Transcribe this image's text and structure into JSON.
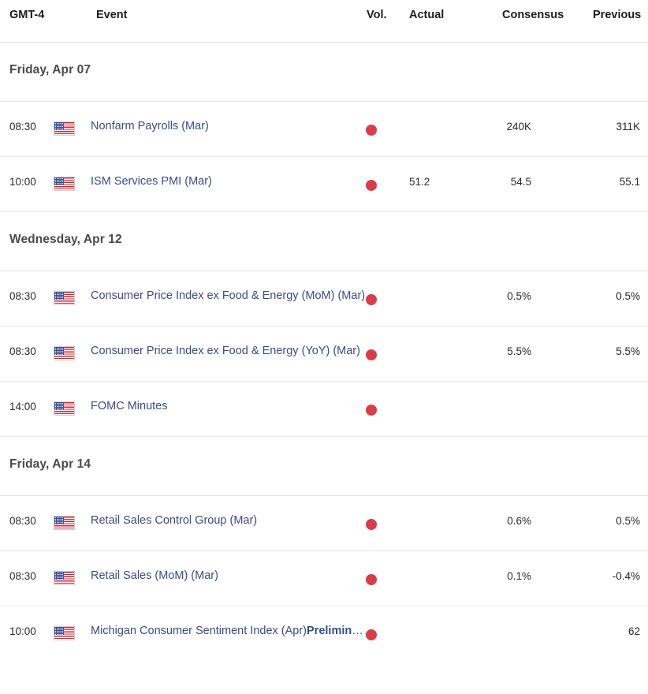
{
  "columns": {
    "timezone": "GMT-4",
    "event": "Event",
    "vol": "Vol.",
    "actual": "Actual",
    "consensus": "Consensus",
    "previous": "Previous"
  },
  "colors": {
    "link": "#3b4a8c",
    "volatility_high": "#d93d4a",
    "divider": "#e2e2e2",
    "date_header_text": "#4a4a4a"
  },
  "icons": {
    "flag": "us-flag-icon",
    "volatility": "volatility-dot-icon"
  },
  "groups": [
    {
      "date": "Friday, Apr 07",
      "rows": [
        {
          "time": "08:30",
          "country": "United States",
          "event": "Nonfarm Payrolls (Mar)",
          "event_prelim": "",
          "volatility": "high",
          "actual": "",
          "consensus": "240K",
          "previous": "311K"
        },
        {
          "time": "10:00",
          "country": "United States",
          "event": "ISM Services PMI (Mar)",
          "event_prelim": "",
          "volatility": "high",
          "actual": "51.2",
          "consensus": "54.5",
          "previous": "55.1"
        }
      ]
    },
    {
      "date": "Wednesday, Apr 12",
      "rows": [
        {
          "time": "08:30",
          "country": "United States",
          "event": "Consumer Price Index ex Food & Energy (MoM) (Mar)",
          "event_prelim": "",
          "volatility": "high",
          "actual": "",
          "consensus": "0.5%",
          "previous": "0.5%"
        },
        {
          "time": "08:30",
          "country": "United States",
          "event": "Consumer Price Index ex Food & Energy (YoY) (Mar)",
          "event_prelim": "",
          "volatility": "high",
          "actual": "",
          "consensus": "5.5%",
          "previous": "5.5%"
        },
        {
          "time": "14:00",
          "country": "United States",
          "event": "FOMC Minutes",
          "event_prelim": "",
          "volatility": "high",
          "actual": "",
          "consensus": "",
          "previous": ""
        }
      ]
    },
    {
      "date": "Friday, Apr 14",
      "rows": [
        {
          "time": "08:30",
          "country": "United States",
          "event": "Retail Sales Control Group (Mar)",
          "event_prelim": "",
          "volatility": "high",
          "actual": "",
          "consensus": "0.6%",
          "previous": "0.5%"
        },
        {
          "time": "08:30",
          "country": "United States",
          "event": "Retail Sales (MoM) (Mar)",
          "event_prelim": "",
          "volatility": "high",
          "actual": "",
          "consensus": "0.1%",
          "previous": "-0.4%"
        },
        {
          "time": "10:00",
          "country": "United States",
          "event": "Michigan Consumer Sentiment Index (Apr)",
          "event_prelim": "Preliminary",
          "volatility": "high",
          "actual": "",
          "consensus": "",
          "previous": "62"
        }
      ]
    }
  ]
}
